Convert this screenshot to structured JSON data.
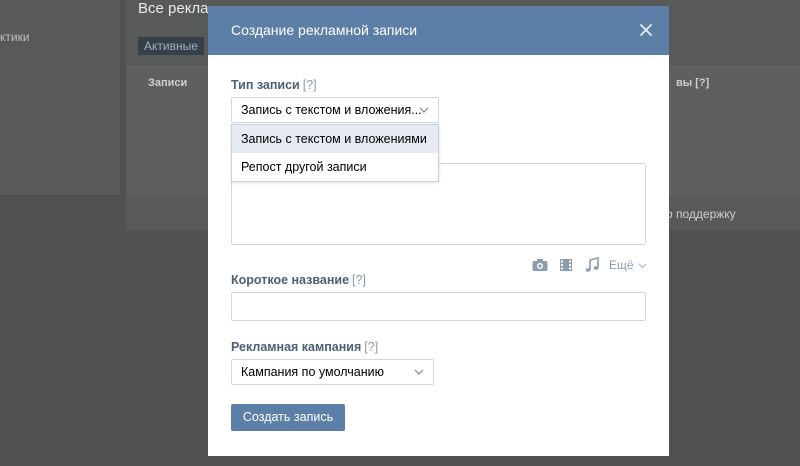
{
  "background": {
    "title": "Все рекла",
    "left_text": "ктики",
    "tab_label": "Активные",
    "col_records": "Записи",
    "col_right": "вы [?]",
    "support_text": "о поддержку"
  },
  "modal": {
    "title": "Создание рекламной записи",
    "close_icon": "close-icon",
    "post_type": {
      "label": "Тип записи",
      "help": "[?]",
      "selected": "Запись с текстом и вложения...",
      "options": [
        "Запись с текстом и вложениями",
        "Репост другой записи"
      ]
    },
    "attachments": {
      "icons": [
        "camera-icon",
        "video-icon",
        "music-icon"
      ],
      "more_label": "Ещё"
    },
    "short_name": {
      "label": "Короткое название",
      "help": "[?]",
      "value": ""
    },
    "campaign": {
      "label": "Рекламная кампания",
      "help": "[?]",
      "selected": "Кампания по умолчанию"
    },
    "submit_label": "Создать запись"
  },
  "colors": {
    "header": "#5b7fa6",
    "label": "#4c5f78",
    "overlay_bg": "#505152",
    "dropdown_active": "#e5ebf1"
  }
}
